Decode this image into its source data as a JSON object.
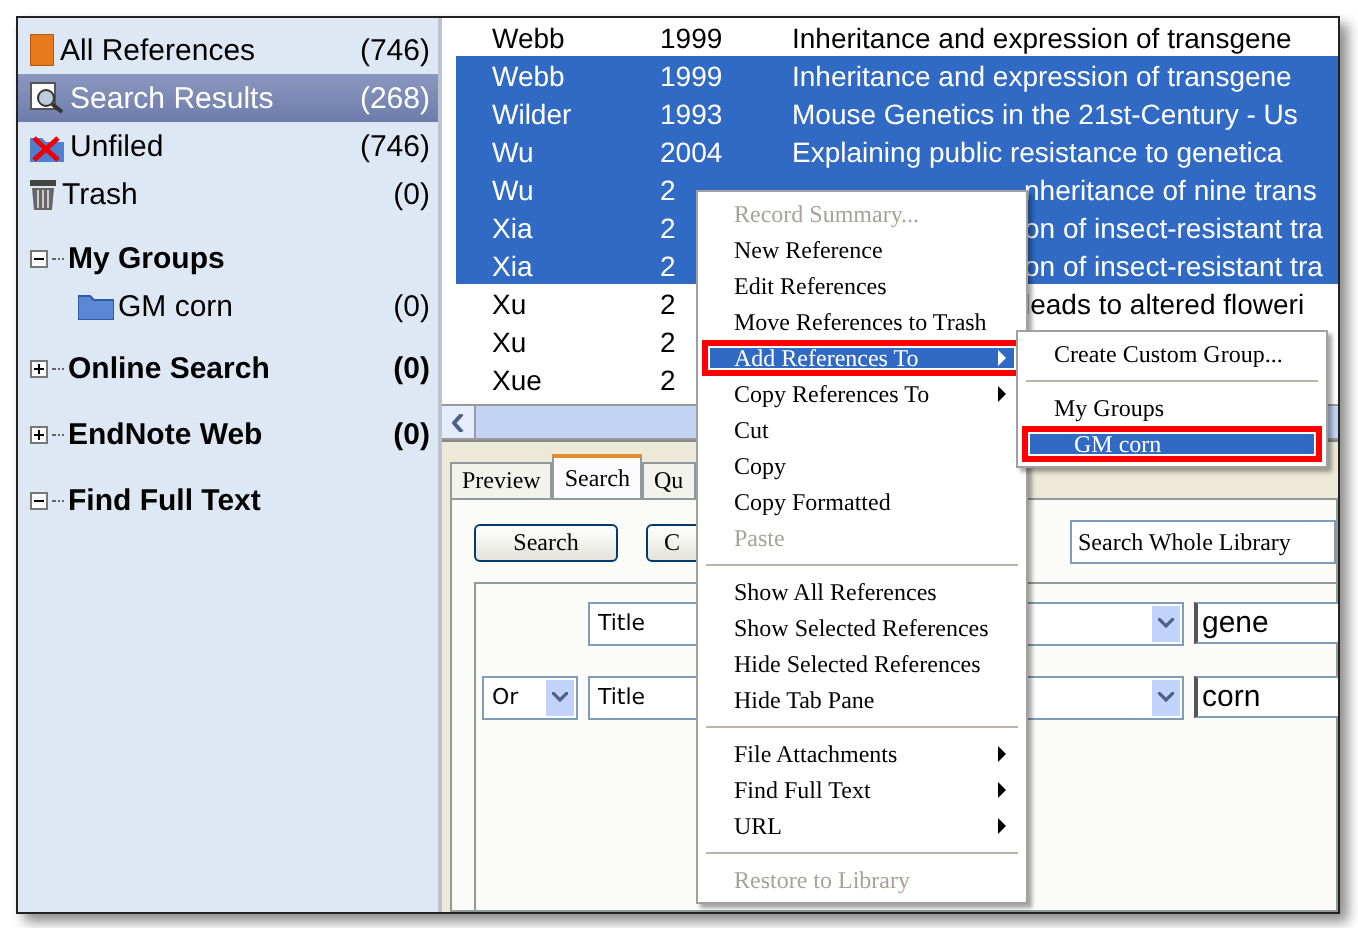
{
  "sidebar": {
    "items": [
      {
        "label": "All References",
        "count": "(746)",
        "kind": "library",
        "selected": false
      },
      {
        "label": "Search Results",
        "count": "(268)",
        "kind": "search",
        "selected": true
      },
      {
        "label": "Unfiled",
        "count": "(746)",
        "kind": "unfiled",
        "selected": false
      },
      {
        "label": "Trash",
        "count": "(0)",
        "kind": "trash",
        "selected": false
      }
    ],
    "groups": [
      {
        "label": "My Groups",
        "expanded": true,
        "children": [
          {
            "label": "GM corn",
            "count": "(0)"
          }
        ]
      },
      {
        "label": "Online Search",
        "count": "(0)",
        "expanded": false
      },
      {
        "label": "EndNote Web",
        "count": "(0)",
        "expanded": false
      },
      {
        "label": "Find Full Text",
        "expanded": true
      }
    ]
  },
  "references": [
    {
      "author": "Webb",
      "year": "1999",
      "title": "Inheritance and expression of transgene",
      "selected": false,
      "covered": false
    },
    {
      "author": "Webb",
      "year": "1999",
      "title": "Inheritance and expression of transgene",
      "selected": true,
      "covered": false
    },
    {
      "author": "Wilder",
      "year": "1993",
      "title": "Mouse Genetics in the 21st-Century - Us",
      "selected": true,
      "covered": false
    },
    {
      "author": "Wu",
      "year": "2004",
      "title": "Explaining public resistance to genetica",
      "selected": true,
      "covered": false
    },
    {
      "author": "Wu",
      "year": "2",
      "title": "nheritance of nine trans",
      "selected": true,
      "covered": true
    },
    {
      "author": "Xia",
      "year": "2",
      "title": "on of insect-resistant tra",
      "selected": true,
      "covered": true
    },
    {
      "author": "Xia",
      "year": "2",
      "title": "on of insect-resistant tra",
      "selected": true,
      "covered": true
    },
    {
      "author": "Xu",
      "year": "2",
      "title": "leads to altered floweri",
      "selected": false,
      "covered": true
    },
    {
      "author": "Xu",
      "year": "2",
      "selected": false
    },
    {
      "author": "Xue",
      "year": "2",
      "selected": false
    }
  ],
  "tabs": [
    {
      "label": "Preview",
      "selected": false
    },
    {
      "label": "Search",
      "selected": true
    },
    {
      "label": "Qu",
      "selected": false
    }
  ],
  "search": {
    "button": "Search",
    "button_2": "C",
    "scope": "Search Whole Library",
    "rows": [
      {
        "field": "Title",
        "value": "gene"
      },
      {
        "operator": "Or",
        "field": "Title",
        "value": "corn"
      }
    ]
  },
  "context_menu": [
    {
      "kind": "item",
      "label": "Record Summary...",
      "disabled": true
    },
    {
      "kind": "item",
      "label": "New Reference",
      "disabled": false
    },
    {
      "kind": "item",
      "label": "Edit References",
      "disabled": false
    },
    {
      "kind": "item",
      "label": "Move References to Trash",
      "disabled": false
    },
    {
      "kind": "submenu",
      "label": "Add References To",
      "disabled": false,
      "highlighted": true,
      "callout": true
    },
    {
      "kind": "submenu",
      "label": "Copy References To",
      "disabled": false
    },
    {
      "kind": "item",
      "label": "Cut",
      "disabled": false
    },
    {
      "kind": "item",
      "label": "Copy",
      "disabled": false
    },
    {
      "kind": "item",
      "label": "Copy Formatted",
      "disabled": false
    },
    {
      "kind": "item",
      "label": "Paste",
      "disabled": true
    },
    {
      "kind": "separator"
    },
    {
      "kind": "item",
      "label": "Show All References",
      "disabled": false
    },
    {
      "kind": "item",
      "label": "Show Selected References",
      "disabled": false
    },
    {
      "kind": "item",
      "label": "Hide Selected References",
      "disabled": false
    },
    {
      "kind": "item",
      "label": "Hide Tab Pane",
      "disabled": false
    },
    {
      "kind": "separator"
    },
    {
      "kind": "submenu",
      "label": "File Attachments",
      "disabled": false
    },
    {
      "kind": "submenu",
      "label": "Find Full Text",
      "disabled": false
    },
    {
      "kind": "submenu",
      "label": "URL",
      "disabled": false
    },
    {
      "kind": "separator"
    },
    {
      "kind": "item",
      "label": "Restore to Library",
      "disabled": true
    }
  ],
  "submenu": [
    {
      "kind": "item",
      "label": "Create Custom Group...",
      "disabled": false
    },
    {
      "kind": "separator"
    },
    {
      "kind": "item",
      "label": "My Groups",
      "disabled": false
    },
    {
      "kind": "item",
      "label": "GM corn",
      "disabled": false,
      "highlighted": true,
      "callout": true,
      "indented": true
    }
  ]
}
